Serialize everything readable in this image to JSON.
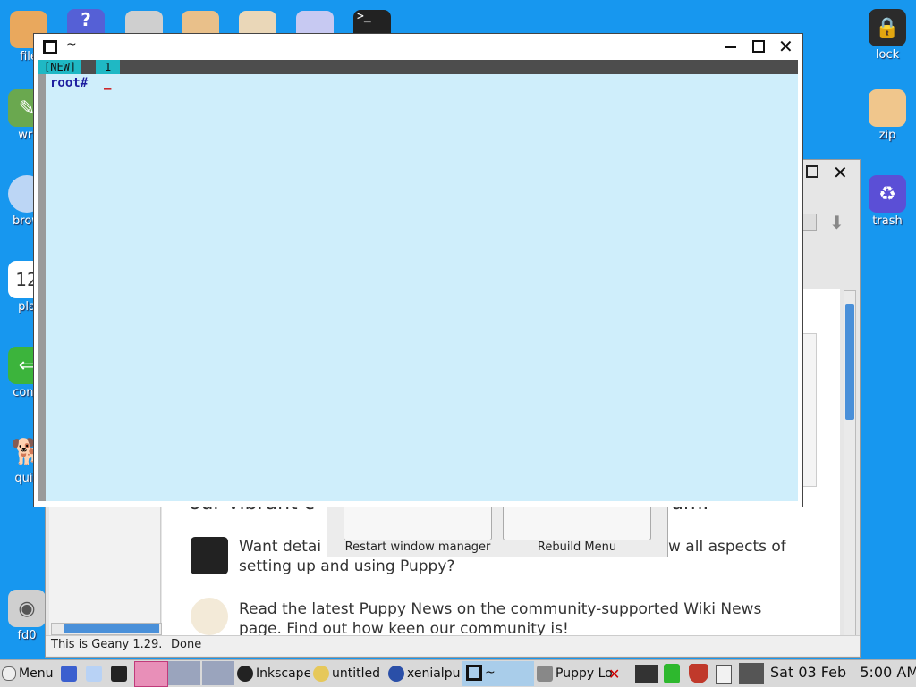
{
  "desktop_icons_left": [
    {
      "label": "file",
      "icon": "folder-icon",
      "color": "#e9a85d"
    },
    {
      "label": "wri",
      "icon": "writer-icon",
      "color": "#6aa84f"
    },
    {
      "label": "brow",
      "icon": "cloud-icon",
      "color": "#a8c8f0"
    },
    {
      "label": "pla",
      "icon": "calendar-icon",
      "color": "#ffffff"
    },
    {
      "label": "conn",
      "icon": "connect-icon",
      "color": "#3cb43c"
    },
    {
      "label": "quic",
      "icon": "dog-icon",
      "color": "#ffffff"
    },
    {
      "label": "fd0",
      "icon": "drive-icon",
      "color": "#cfcfcf"
    }
  ],
  "desktop_icons_right": [
    {
      "label": "lock",
      "icon": "lock-icon"
    },
    {
      "label": "zip",
      "icon": "zip-icon"
    },
    {
      "label": "trash",
      "icon": "trash-icon"
    }
  ],
  "terminal": {
    "title": "~",
    "tab_new": "[NEW]",
    "tab_num": "1",
    "prompt": "root#",
    "cursor": "_"
  },
  "browser": {
    "para1_line1": "our vibrant c",
    "para1_line2_tail": "rum.",
    "para2_line1": "Want detai",
    "para2_line1_tail": "w all aspects of",
    "para2_line2": "setting up and using Puppy?",
    "para3_line1": "Read the latest Puppy News on the community-supported Wiki News",
    "para3_line2": "page. Find out how keen our community is!",
    "status_left": "This is Geany 1.29.",
    "status_main": "Done"
  },
  "dialog": {
    "restart": "Restart window manager",
    "rebuild": "Rebuild Menu"
  },
  "taskbar": {
    "menu_label": "Menu",
    "items": [
      "Inkscape",
      "untitled",
      "xenialpu",
      "~",
      "Puppy Lo"
    ],
    "clock": "Sat 03 Feb   5:00 AM"
  },
  "colors": {
    "desktop": "#1797ef",
    "terminal_bg": "#cfeefb",
    "prompt": "#1d1d9f",
    "cursor": "#cc0000",
    "tab_active": "#1fb8c4"
  }
}
